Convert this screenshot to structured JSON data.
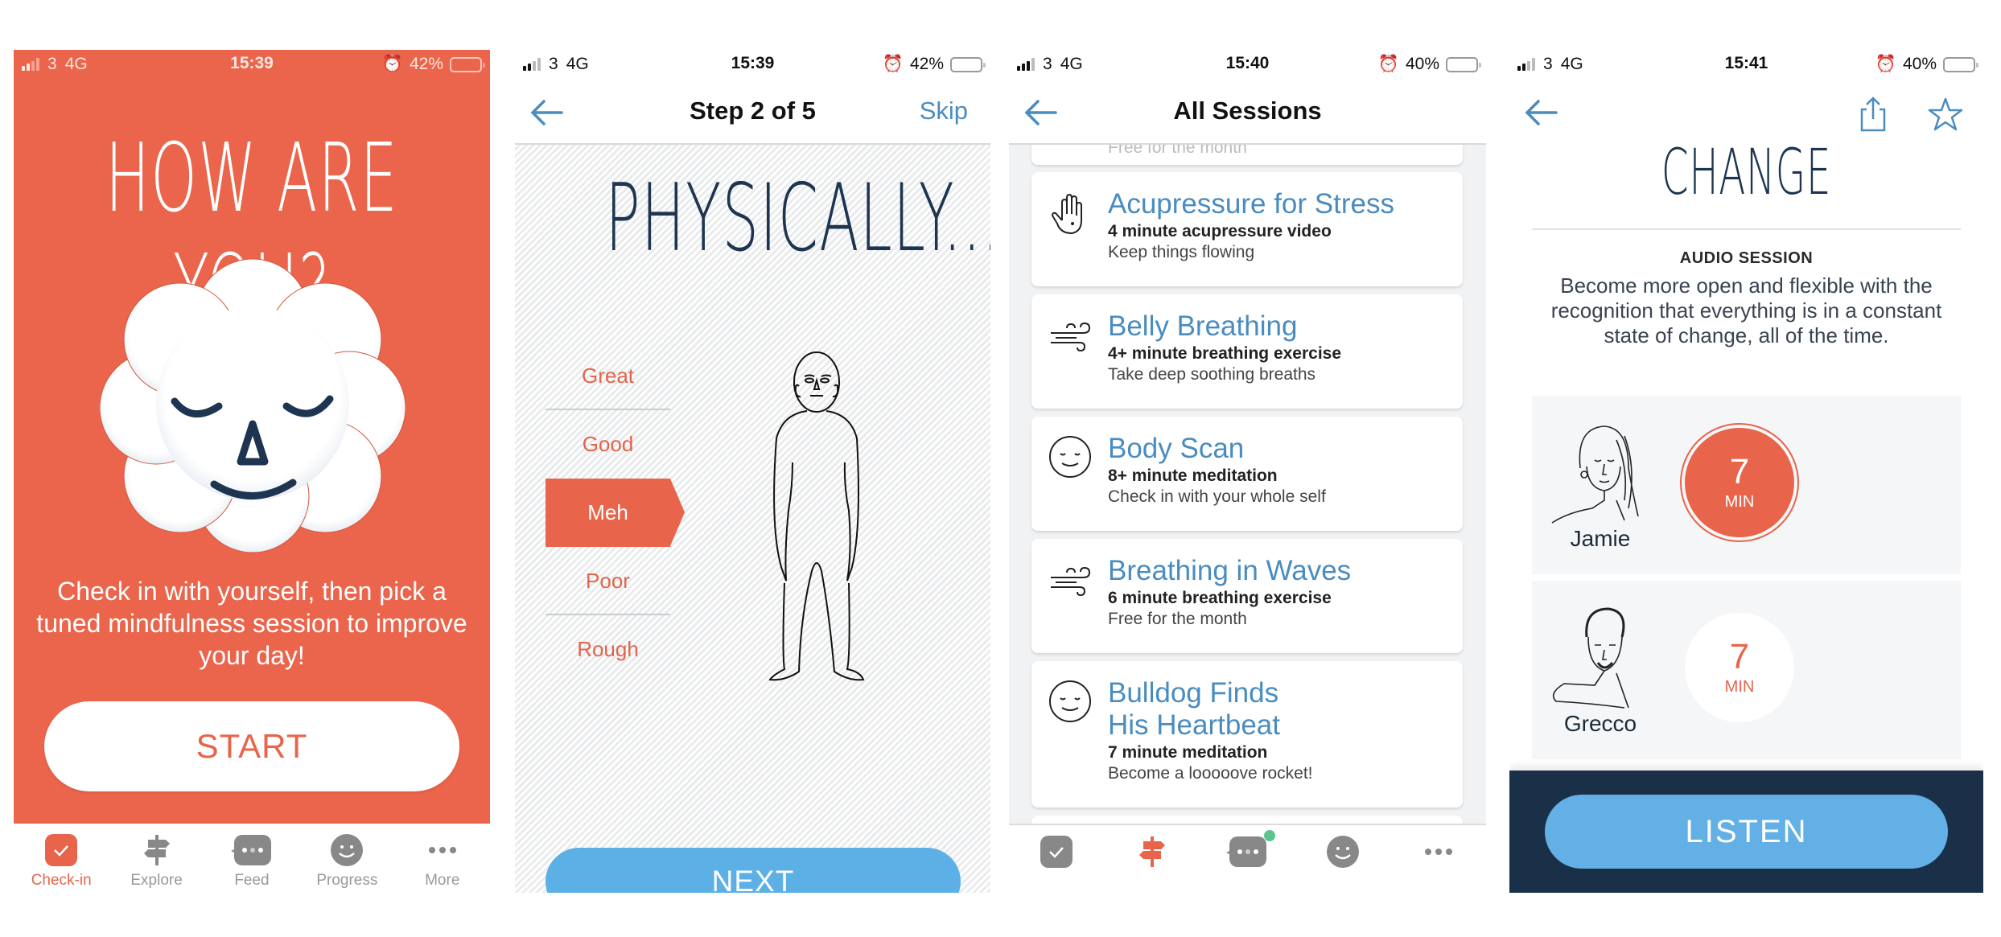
{
  "colors": {
    "brand_orange": "#e8644b",
    "accent_blue": "#4a8cc0",
    "button_blue": "#5cb0e6",
    "navy": "#1d3551",
    "footer_navy": "#1a3049",
    "notification_green": "#5cc48a"
  },
  "screens": [
    {
      "status": {
        "carrier": "3",
        "network": "4G",
        "time": "15:39",
        "battery": "42%",
        "battery_level": 0.42,
        "alarm_icon": "alarm-icon"
      },
      "title": "HOW ARE YOU?",
      "tagline": "Check in with yourself, then pick a tuned mindfulness session to improve your day!",
      "start_label": "START",
      "tabs": [
        {
          "label": "Check-in",
          "icon": "check-in-icon",
          "active": true
        },
        {
          "label": "Explore",
          "icon": "signpost-icon",
          "active": false
        },
        {
          "label": "Feed",
          "icon": "chat-bubble-icon",
          "active": false
        },
        {
          "label": "Progress",
          "icon": "smiley-icon",
          "active": false
        },
        {
          "label": "More",
          "icon": "more-dots-icon",
          "active": false
        }
      ]
    },
    {
      "status": {
        "carrier": "3",
        "network": "4G",
        "time": "15:39",
        "battery": "42%",
        "battery_level": 0.42
      },
      "nav_title": "Step 2 of 5",
      "skip_label": "Skip",
      "step": {
        "current": 2,
        "total": 5
      },
      "title": "PHYSICALLY...",
      "moods": [
        "Great",
        "Good",
        "Meh",
        "Poor",
        "Rough"
      ],
      "selected_mood": "Meh",
      "next_label": "NEXT"
    },
    {
      "status": {
        "carrier": "3",
        "network": "4G",
        "time": "15:40",
        "battery": "40%",
        "battery_level": 0.4
      },
      "nav_title": "All Sessions",
      "partial_card_desc": "Free for the month",
      "sessions": [
        {
          "title": "Acupressure for Stress",
          "duration": "4 minute acupressure video",
          "desc": "Keep things flowing",
          "icon": "hand-icon"
        },
        {
          "title": "Belly Breathing",
          "duration": "4+ minute breathing exercise",
          "desc": "Take deep soothing breaths",
          "icon": "wind-icon"
        },
        {
          "title": "Body Scan",
          "duration": "8+ minute meditation",
          "desc": "Check in with your whole self",
          "icon": "calm-face-icon"
        },
        {
          "title": "Breathing in Waves",
          "duration": "6 minute breathing exercise",
          "desc": "Free for the month",
          "icon": "wind-icon"
        },
        {
          "title": "Bulldog Finds His Heartbeat",
          "duration": "7 minute meditation",
          "desc": "Become a looooove rocket!",
          "icon": "calm-face-icon"
        }
      ],
      "tabs": [
        {
          "icon": "check-in-icon",
          "active": false
        },
        {
          "icon": "signpost-icon",
          "active": true
        },
        {
          "icon": "chat-bubble-icon",
          "active": false,
          "badge": true
        },
        {
          "icon": "smiley-icon",
          "active": false
        },
        {
          "icon": "more-dots-icon",
          "active": false
        }
      ]
    },
    {
      "status": {
        "carrier": "3",
        "network": "4G",
        "time": "15:41",
        "battery": "40%",
        "battery_level": 0.4
      },
      "title": "CHANGE",
      "kicker": "AUDIO SESSION",
      "description": "Become more open and flexible with the recognition that everything is in a constant state of change, all of the time.",
      "guides": [
        {
          "name": "Jamie",
          "duration": "7",
          "unit": "MIN",
          "selected": true
        },
        {
          "name": "Grecco",
          "duration": "7",
          "unit": "MIN",
          "selected": false
        }
      ],
      "listen_label": "LISTEN"
    }
  ]
}
